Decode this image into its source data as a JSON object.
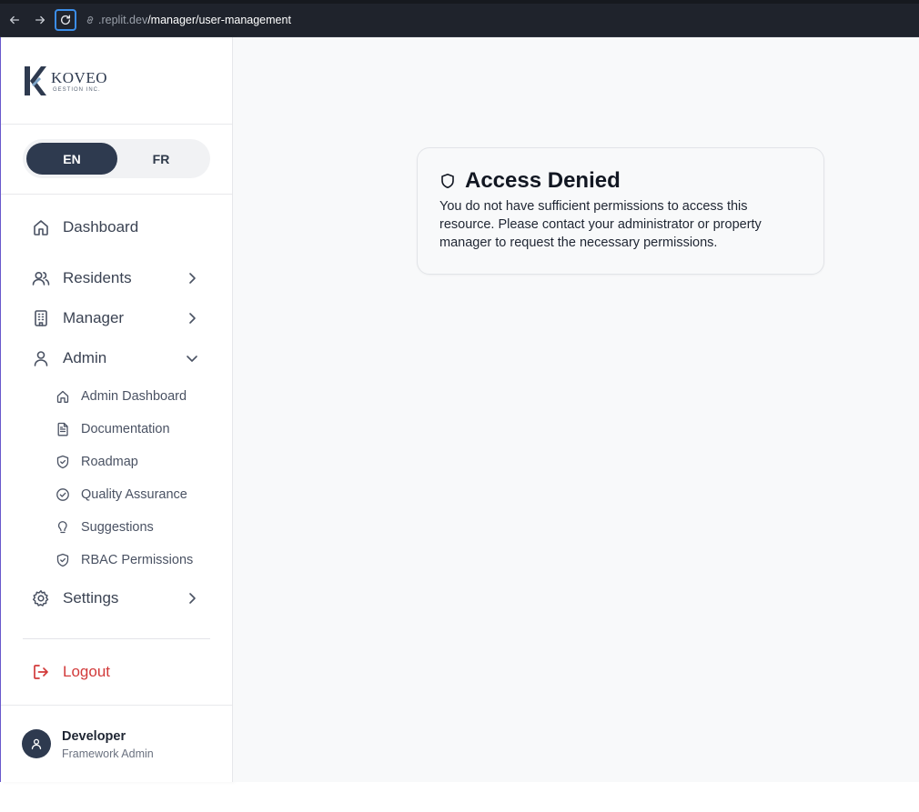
{
  "browser": {
    "url_prefix": ".replit.dev",
    "url_path": "/manager/user-management"
  },
  "sidebar": {
    "logo_text": "KOVEO",
    "logo_subtext": "GESTION INC.",
    "languages": [
      "EN",
      "FR"
    ],
    "active_language": "EN",
    "nav": [
      {
        "label": "Dashboard",
        "icon": "home-icon"
      },
      {
        "label": "Residents",
        "icon": "users-icon"
      },
      {
        "label": "Manager",
        "icon": "building-icon"
      },
      {
        "label": "Admin",
        "icon": "user-icon"
      },
      {
        "label": "Settings",
        "icon": "gear-icon"
      }
    ],
    "admin_sub": [
      {
        "label": "Admin Dashboard",
        "icon": "home-icon"
      },
      {
        "label": "Documentation",
        "icon": "file-text-icon"
      },
      {
        "label": "Roadmap",
        "icon": "shield-icon"
      },
      {
        "label": "Quality Assurance",
        "icon": "check-circle-icon"
      },
      {
        "label": "Suggestions",
        "icon": "lightbulb-icon"
      },
      {
        "label": "RBAC Permissions",
        "icon": "shield-icon"
      }
    ],
    "logout_label": "Logout",
    "user": {
      "name": "Developer",
      "role": "Framework Admin"
    }
  },
  "alert": {
    "title": "Access Denied",
    "message": "You do not have sufficient permissions to access this resource. Please contact your administrator or property manager to request the necessary permissions."
  },
  "colors": {
    "accent_dark": "#2e3a4f",
    "logout_red": "#d23a3a",
    "main_bg": "#f8f9fa"
  }
}
